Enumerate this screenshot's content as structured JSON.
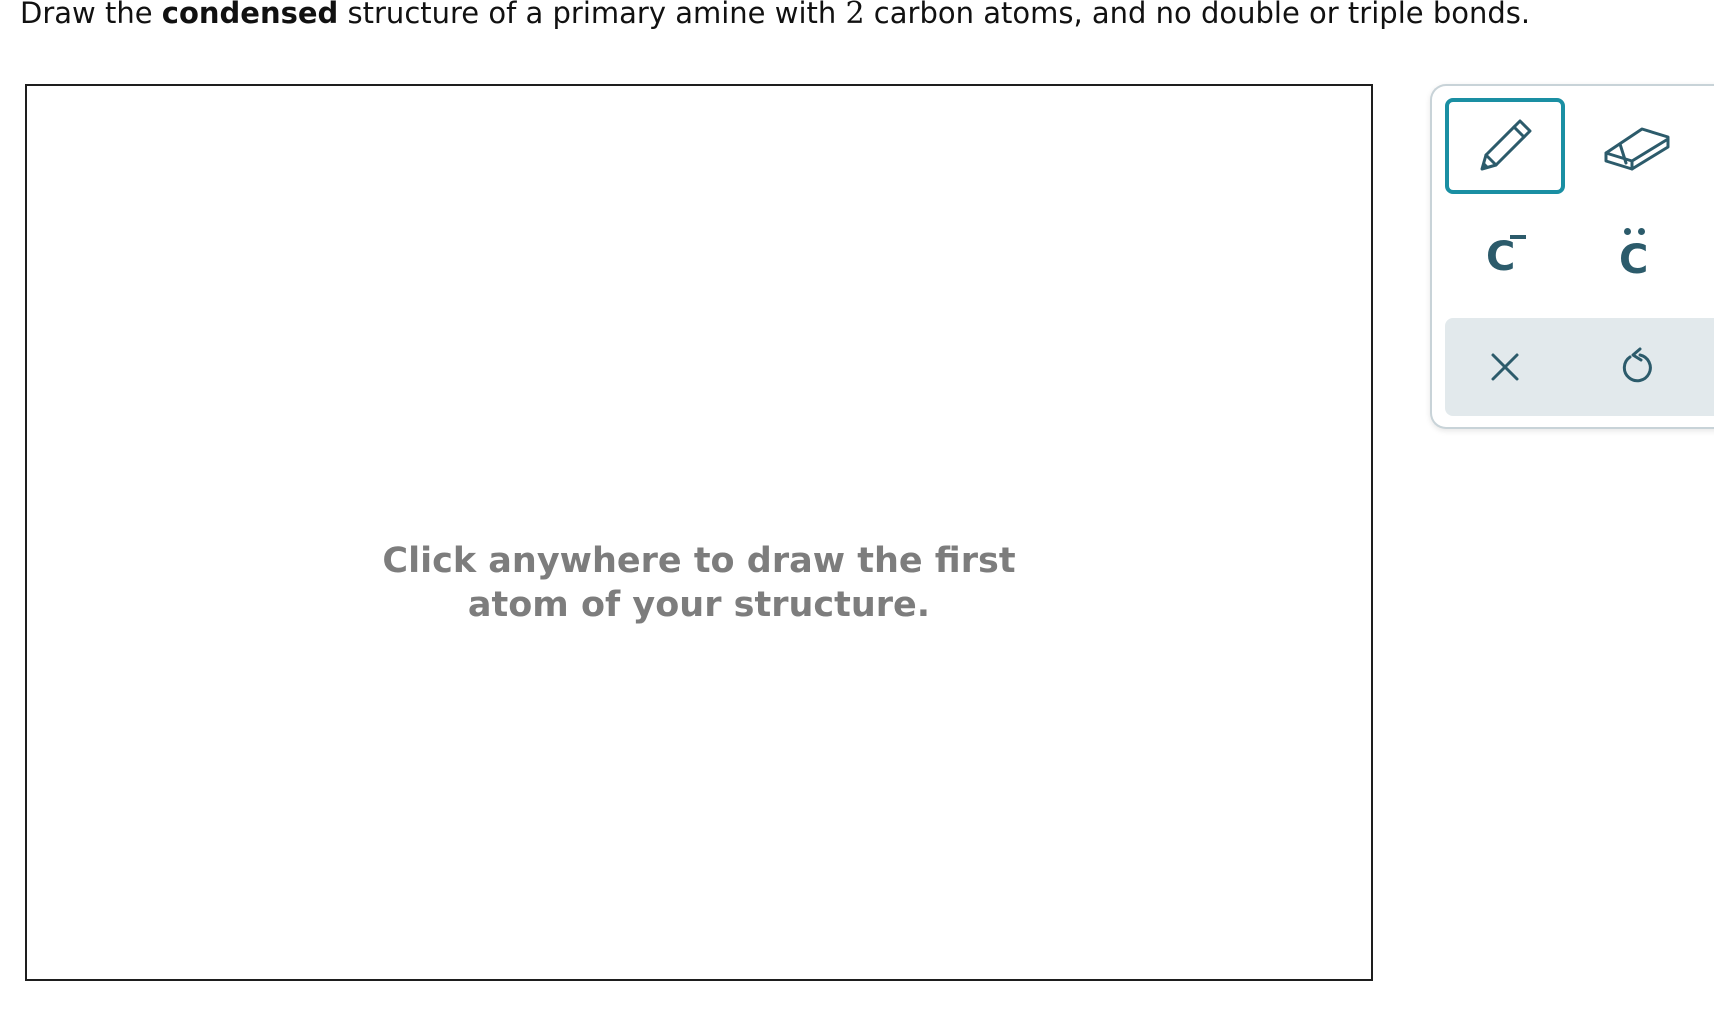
{
  "question": {
    "text_before": "Draw the ",
    "bold_word": "condensed",
    "text_middle": " structure of a primary amine with ",
    "number": "2",
    "text_after": " carbon atoms, and no double or triple bonds."
  },
  "canvas": {
    "placeholder_line1": "Click anywhere to draw the first",
    "placeholder_line2": "atom of your structure."
  },
  "toolbar": {
    "tools": [
      {
        "name": "pencil-icon",
        "active": true
      },
      {
        "name": "eraser-icon",
        "active": false
      },
      {
        "name": "charge-icon",
        "glyph": "C",
        "active": false
      },
      {
        "name": "lone-pair-icon",
        "glyph": "C",
        "active": false
      }
    ],
    "actions": [
      {
        "name": "clear-icon"
      },
      {
        "name": "undo-icon"
      }
    ]
  },
  "colors": {
    "accent": "#1a8fa3",
    "icon": "#2c5b6b",
    "placeholder_text": "#7d7d7d",
    "action_bar_bg": "#e2e9ec",
    "toolbar_border": "#c8d3d8"
  }
}
